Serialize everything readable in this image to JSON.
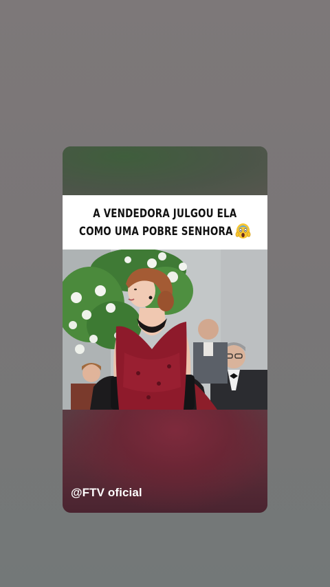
{
  "post": {
    "caption_line_1": "A VENDEDORA JULGOU ELA",
    "caption_line_2": "COMO UMA POBRE SENHORA",
    "caption_emoji": "screaming-face-emoji",
    "watermark": "@FTV oficial"
  },
  "colors": {
    "background": "#7a7677",
    "caption_bg": "#ffffff",
    "caption_text": "#111111",
    "dress": "#8e1a2b"
  }
}
